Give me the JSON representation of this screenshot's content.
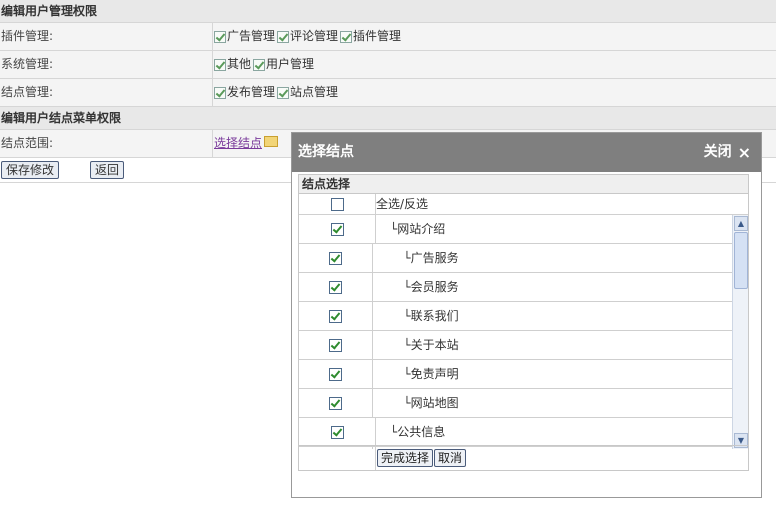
{
  "form": {
    "section1_title": "编辑用户管理权限",
    "rows": [
      {
        "label": "插件管理:",
        "options": [
          {
            "label": "广告管理",
            "checked": true
          },
          {
            "label": "评论管理",
            "checked": true
          },
          {
            "label": "插件管理",
            "checked": true
          }
        ]
      },
      {
        "label": "系统管理:",
        "options": [
          {
            "label": "其他",
            "checked": true
          },
          {
            "label": "用户管理",
            "checked": true
          }
        ]
      },
      {
        "label": "结点管理:",
        "options": [
          {
            "label": "发布管理",
            "checked": true
          },
          {
            "label": "站点管理",
            "checked": true
          }
        ]
      }
    ],
    "section2_title": "编辑用户结点菜单权限",
    "scope_label": "结点范围:",
    "scope_link": "选择结点",
    "save_button": "保存修改",
    "back_button": "返回"
  },
  "modal": {
    "title": "选择结点",
    "close_label": "关闭",
    "close_icon": "×",
    "panel_title": "结点选择",
    "select_all_label": "全选/反选",
    "select_all_checked": false,
    "nodes": [
      {
        "label": "└网站介绍",
        "level": 1,
        "checked": true
      },
      {
        "label": "└广告服务",
        "level": 2,
        "checked": true
      },
      {
        "label": "└会员服务",
        "level": 2,
        "checked": true
      },
      {
        "label": "└联系我们",
        "level": 2,
        "checked": true
      },
      {
        "label": "└关于本站",
        "level": 2,
        "checked": true
      },
      {
        "label": "└免责声明",
        "level": 2,
        "checked": true
      },
      {
        "label": "└网站地图",
        "level": 2,
        "checked": true
      },
      {
        "label": "└公共信息",
        "level": 1,
        "checked": true
      },
      {
        "label": "",
        "level": 2,
        "checked": true
      }
    ],
    "done_button": "完成选择",
    "cancel_button": "取消",
    "scroll_up_icon": "▲",
    "scroll_down_icon": "▼"
  },
  "colors": {
    "modal_title_bg": "#7f7f7f",
    "link": "#7a3b9b",
    "check": "#2e8b2e"
  }
}
